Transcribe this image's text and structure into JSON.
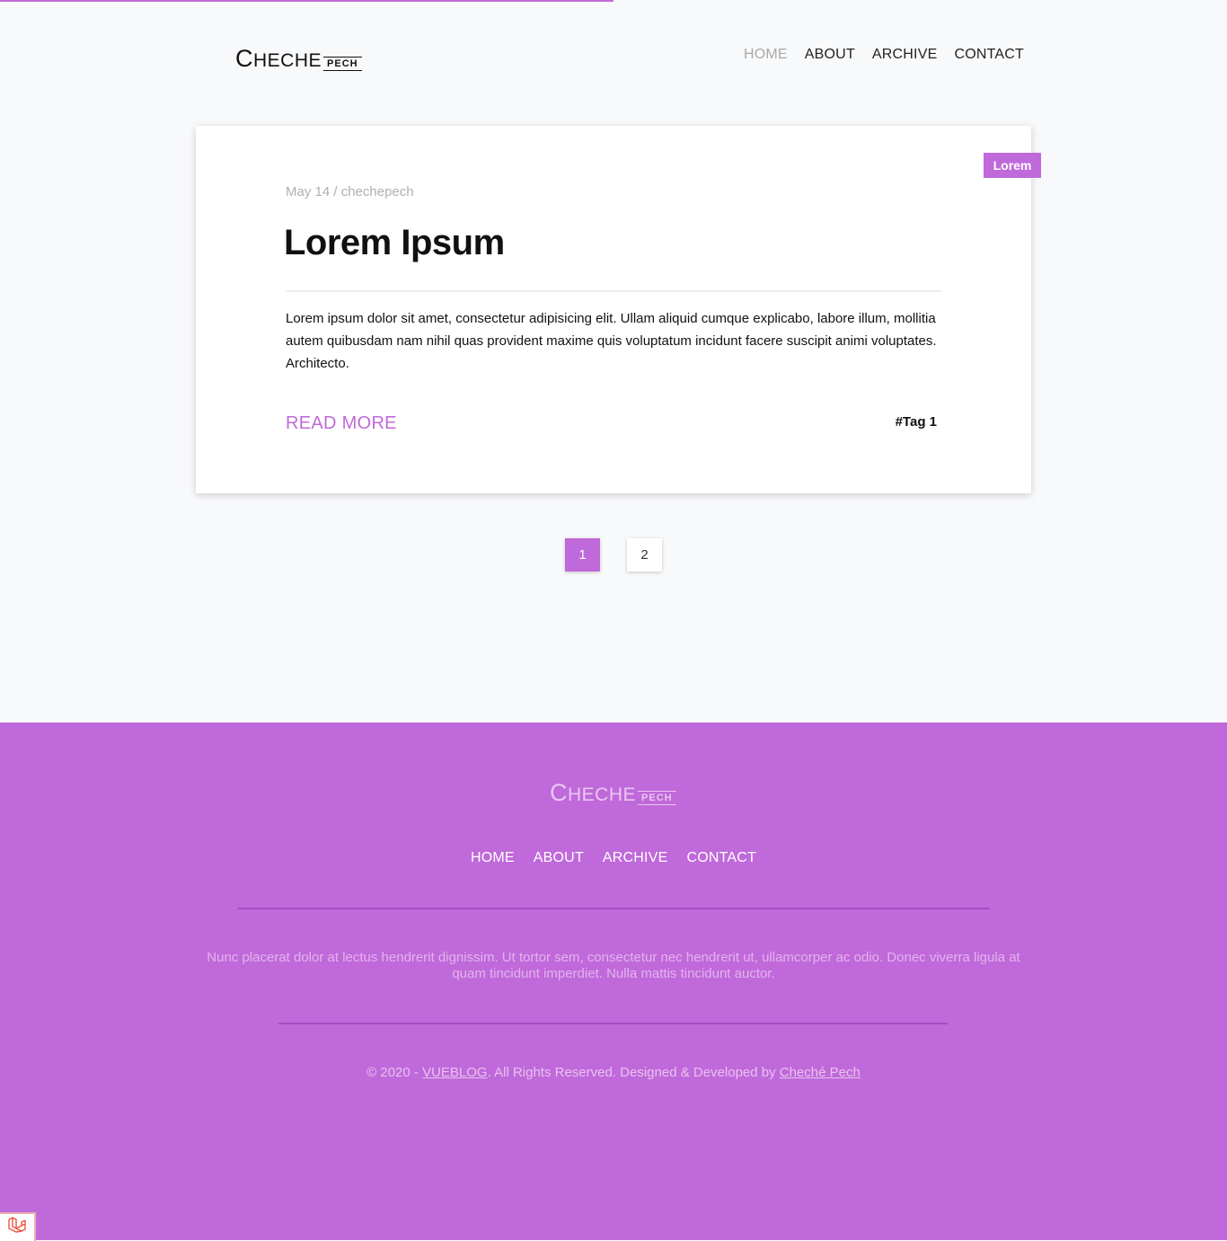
{
  "header": {
    "logo": {
      "main_big": "C",
      "main_rest": "HECHE",
      "sub": "PECH"
    },
    "nav": [
      {
        "label": "HOME"
      },
      {
        "label": "ABOUT"
      },
      {
        "label": "ARCHIVE"
      },
      {
        "label": "CONTACT"
      }
    ],
    "progress_percent": 50
  },
  "post": {
    "category": "Lorem",
    "date": "May 14",
    "author": "chechepech",
    "meta_separator": " / ",
    "title": "Lorem Ipsum",
    "excerpt": "Lorem ipsum dolor sit amet, consectetur adipisicing elit. Ullam aliquid cumque explicabo, labore illum, mollitia autem quibusdam nam nihil quas provident maxime quis voluptatum incidunt facere suscipit animi voluptates. Architecto.",
    "read_more": "READ MORE",
    "tag": "#Tag 1"
  },
  "pagination": {
    "pages": [
      "1",
      "2"
    ],
    "current": "1"
  },
  "footer": {
    "logo": {
      "main_big": "C",
      "main_rest": "HECHE",
      "sub": "PECH"
    },
    "nav": [
      {
        "label": "HOME"
      },
      {
        "label": "ABOUT"
      },
      {
        "label": "ARCHIVE"
      },
      {
        "label": "CONTACT"
      }
    ],
    "description": "Nunc placerat dolor at lectus hendrerit dignissim. Ut tortor sem, consectetur nec hendrerit ut, ullamcorper ac odio. Donec viverra ligula at quam tincidunt imperdiet. Nulla mattis tincidunt auctor.",
    "copyright_prefix": "© 2020 - ",
    "copyright_link1": "VUEBLOG",
    "copyright_middle": ". All Rights Reserved. Designed & Developed by ",
    "copyright_link2": "Cheché Pech"
  },
  "colors": {
    "accent": "#c069da",
    "background": "#f8f9fb"
  },
  "icons": {
    "corner_widget": "laravel-icon"
  }
}
